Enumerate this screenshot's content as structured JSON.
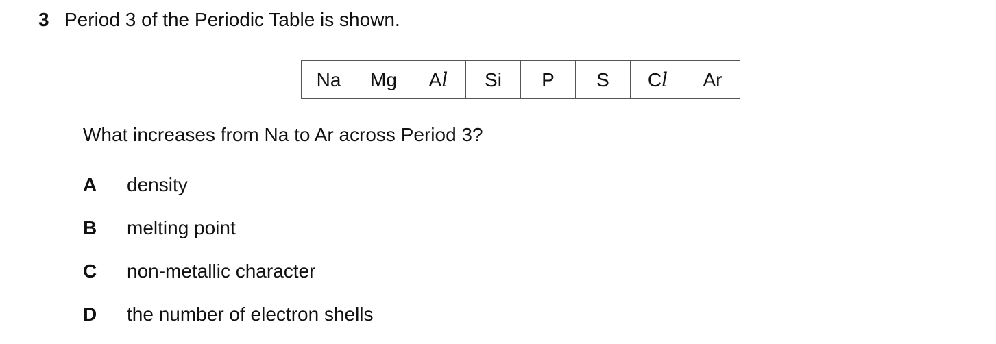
{
  "question": {
    "number": "3",
    "title": "Period 3 of the Periodic Table is shown.",
    "prompt": "What increases from Na to Ar across Period 3?"
  },
  "period_table": {
    "elements": [
      {
        "symbol": "Na",
        "base": "Na",
        "italic_suffix": ""
      },
      {
        "symbol": "Mg",
        "base": "Mg",
        "italic_suffix": ""
      },
      {
        "symbol": "Al",
        "base": "A",
        "italic_suffix": "l"
      },
      {
        "symbol": "Si",
        "base": "Si",
        "italic_suffix": ""
      },
      {
        "symbol": "P",
        "base": "P",
        "italic_suffix": ""
      },
      {
        "symbol": "S",
        "base": "S",
        "italic_suffix": ""
      },
      {
        "symbol": "Cl",
        "base": "C",
        "italic_suffix": "l"
      },
      {
        "symbol": "Ar",
        "base": "Ar",
        "italic_suffix": ""
      }
    ]
  },
  "options": [
    {
      "letter": "A",
      "text": "density"
    },
    {
      "letter": "B",
      "text": "melting point"
    },
    {
      "letter": "C",
      "text": "non-metallic character"
    },
    {
      "letter": "D",
      "text": "the number of electron shells"
    }
  ]
}
